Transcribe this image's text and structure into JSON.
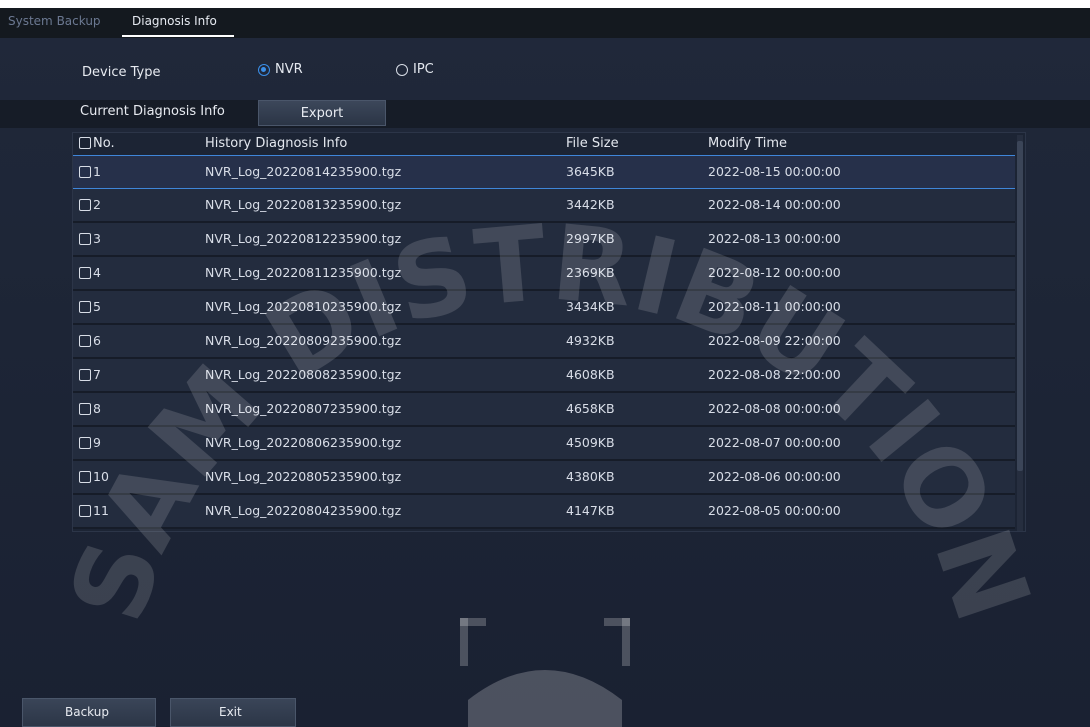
{
  "tabs": {
    "system_backup": "System Backup",
    "diagnosis_info": "Diagnosis Info"
  },
  "device_type": {
    "label": "Device Type",
    "options": [
      "NVR",
      "IPC"
    ],
    "selected": "NVR"
  },
  "current": {
    "label": "Current Diagnosis Info",
    "export_label": "Export"
  },
  "table": {
    "headers": {
      "no": "No.",
      "name": "History Diagnosis Info",
      "size": "File Size",
      "time": "Modify Time"
    },
    "selected_row": 1,
    "rows": [
      {
        "no": "1",
        "name": "NVR_Log_20220814235900.tgz",
        "size": "3645KB",
        "time": "2022-08-15 00:00:00"
      },
      {
        "no": "2",
        "name": "NVR_Log_20220813235900.tgz",
        "size": "3442KB",
        "time": "2022-08-14 00:00:00"
      },
      {
        "no": "3",
        "name": "NVR_Log_20220812235900.tgz",
        "size": "2997KB",
        "time": "2022-08-13 00:00:00"
      },
      {
        "no": "4",
        "name": "NVR_Log_20220811235900.tgz",
        "size": "2369KB",
        "time": "2022-08-12 00:00:00"
      },
      {
        "no": "5",
        "name": "NVR_Log_20220810235900.tgz",
        "size": "3434KB",
        "time": "2022-08-11 00:00:00"
      },
      {
        "no": "6",
        "name": "NVR_Log_20220809235900.tgz",
        "size": "4932KB",
        "time": "2022-08-09 22:00:00"
      },
      {
        "no": "7",
        "name": "NVR_Log_20220808235900.tgz",
        "size": "4608KB",
        "time": "2022-08-08 22:00:00"
      },
      {
        "no": "8",
        "name": "NVR_Log_20220807235900.tgz",
        "size": "4658KB",
        "time": "2022-08-08 00:00:00"
      },
      {
        "no": "9",
        "name": "NVR_Log_20220806235900.tgz",
        "size": "4509KB",
        "time": "2022-08-07 00:00:00"
      },
      {
        "no": "10",
        "name": "NVR_Log_20220805235900.tgz",
        "size": "4380KB",
        "time": "2022-08-06 00:00:00"
      },
      {
        "no": "11",
        "name": "NVR_Log_20220804235900.tgz",
        "size": "4147KB",
        "time": "2022-08-05 00:00:00"
      }
    ]
  },
  "buttons": {
    "backup": "Backup",
    "exit": "Exit"
  },
  "watermark": {
    "text": "SAM DISTRIBUTION",
    "color": "#ffffff"
  }
}
